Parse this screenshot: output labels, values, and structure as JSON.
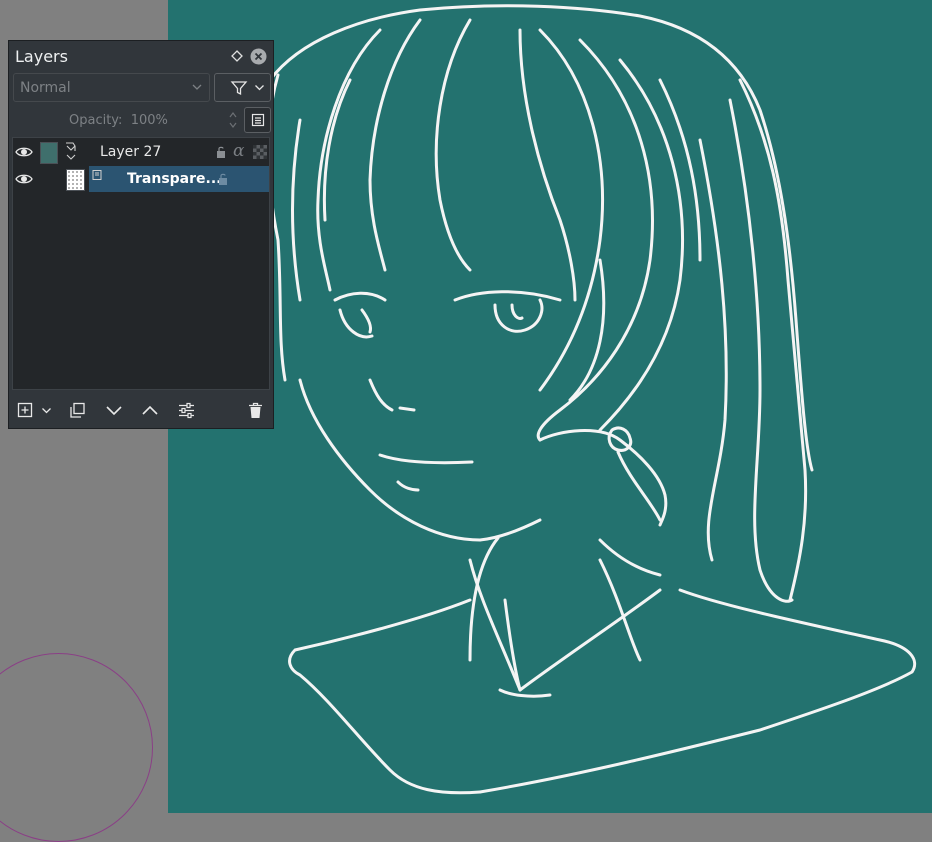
{
  "panel": {
    "title": "Layers",
    "blend_mode": "Normal",
    "opacity_label": "Opacity:",
    "opacity_value": "100%",
    "opacity_text": "Opacity:  100%"
  },
  "layers": [
    {
      "name": "Layer 27",
      "visible": true,
      "selected": false,
      "thumb_color": "#3f6f6c"
    },
    {
      "name": "Transpare...",
      "visible": true,
      "selected": true
    }
  ],
  "colors": {
    "canvas_background": "#23726f",
    "workspace": "#808080",
    "line_art": "#f4f4f4",
    "brush_outline": "#8a3f86",
    "selection": "#2b5471"
  },
  "toolbar_icons": [
    "add-layer-icon",
    "add-layer-dropdown-icon",
    "duplicate-layer-icon",
    "move-layer-down-icon",
    "move-layer-up-icon",
    "layer-properties-icon",
    "delete-layer-icon"
  ]
}
